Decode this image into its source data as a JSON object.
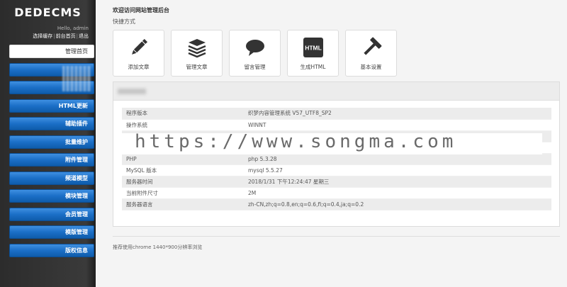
{
  "sidebar": {
    "logo": "DEDECMS",
    "greeting": "Hello, admin",
    "links": [
      "选择缓存",
      "前台首页",
      "退出"
    ],
    "menu": [
      {
        "label": "管理首页",
        "active": true
      },
      {
        "label": "",
        "active": false
      },
      {
        "label": "",
        "active": false
      },
      {
        "label": "HTML更新",
        "active": false
      },
      {
        "label": "辅助插件",
        "active": false
      },
      {
        "label": "批量维护",
        "active": false
      },
      {
        "label": "附件管理",
        "active": false
      },
      {
        "label": "频道模型",
        "active": false
      },
      {
        "label": "模块管理",
        "active": false
      },
      {
        "label": "会员管理",
        "active": false
      },
      {
        "label": "模版管理",
        "active": false
      },
      {
        "label": "版权信息",
        "active": false
      }
    ]
  },
  "main": {
    "welcome": "欢迎访问网站管理后台",
    "quick_title": "快捷方式",
    "shortcuts": [
      {
        "label": "添加文章",
        "icon": "pencil-icon"
      },
      {
        "label": "管理文章",
        "icon": "papers-icon"
      },
      {
        "label": "留言管理",
        "icon": "speech-bubble-icon"
      },
      {
        "label": "生成HTML",
        "icon": "html-icon",
        "icon_text": "HTML"
      },
      {
        "label": "基本设置",
        "icon": "hammer-icon"
      }
    ],
    "info": [
      {
        "key": "程序版本",
        "value": "织梦内容管理系统 V57_UTF8_SP2"
      },
      {
        "key": "操作系统",
        "value": "WINNT"
      },
      {
        "key": "",
        "value": ""
      },
      {
        "key": "PHP",
        "value": "php 5.3.28"
      },
      {
        "key": "MySQL 版本",
        "value": "mysql 5.5.27"
      },
      {
        "key": "服务器时间",
        "value": "2018/1/31 下午12:24:47 星期三"
      },
      {
        "key": "当前附件尺寸",
        "value": "2M"
      },
      {
        "key": "服务器语言",
        "value": "zh-CN,zh;q=0.8,en;q=0.6,fi;q=0.4,ja;q=0.2"
      }
    ],
    "watermark": "https://www.songma.com",
    "footer": "推荐使用chrome 1440*900分辨率浏览"
  },
  "colors": {
    "sidebar_bg": "#2c2c2c",
    "menu_blue": "#1b6fc7",
    "icon_dark": "#333333"
  }
}
